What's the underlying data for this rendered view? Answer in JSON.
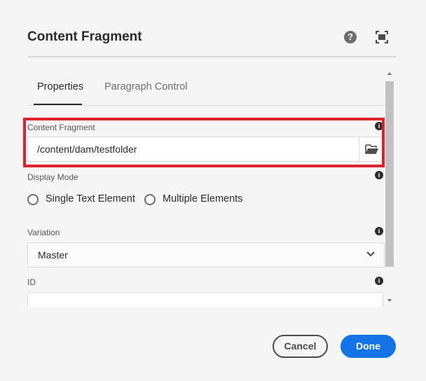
{
  "dialog": {
    "title": "Content Fragment",
    "help_icon": "?"
  },
  "tabs": [
    {
      "label": "Properties",
      "active": true
    },
    {
      "label": "Paragraph Control",
      "active": false
    }
  ],
  "fields": {
    "content_fragment": {
      "label": "Content Fragment",
      "value": "/content/dam/testfolder"
    },
    "display_mode": {
      "label": "Display Mode",
      "options": [
        {
          "label": "Single Text Element",
          "selected": false
        },
        {
          "label": "Multiple Elements",
          "selected": false
        }
      ]
    },
    "variation": {
      "label": "Variation",
      "selected": "Master"
    },
    "id": {
      "label": "ID",
      "value": ""
    }
  },
  "info_icon_glyph": "i",
  "footer": {
    "cancel_label": "Cancel",
    "done_label": "Done"
  },
  "colors": {
    "primary": "#1473e6",
    "highlight": "#e0202d"
  }
}
